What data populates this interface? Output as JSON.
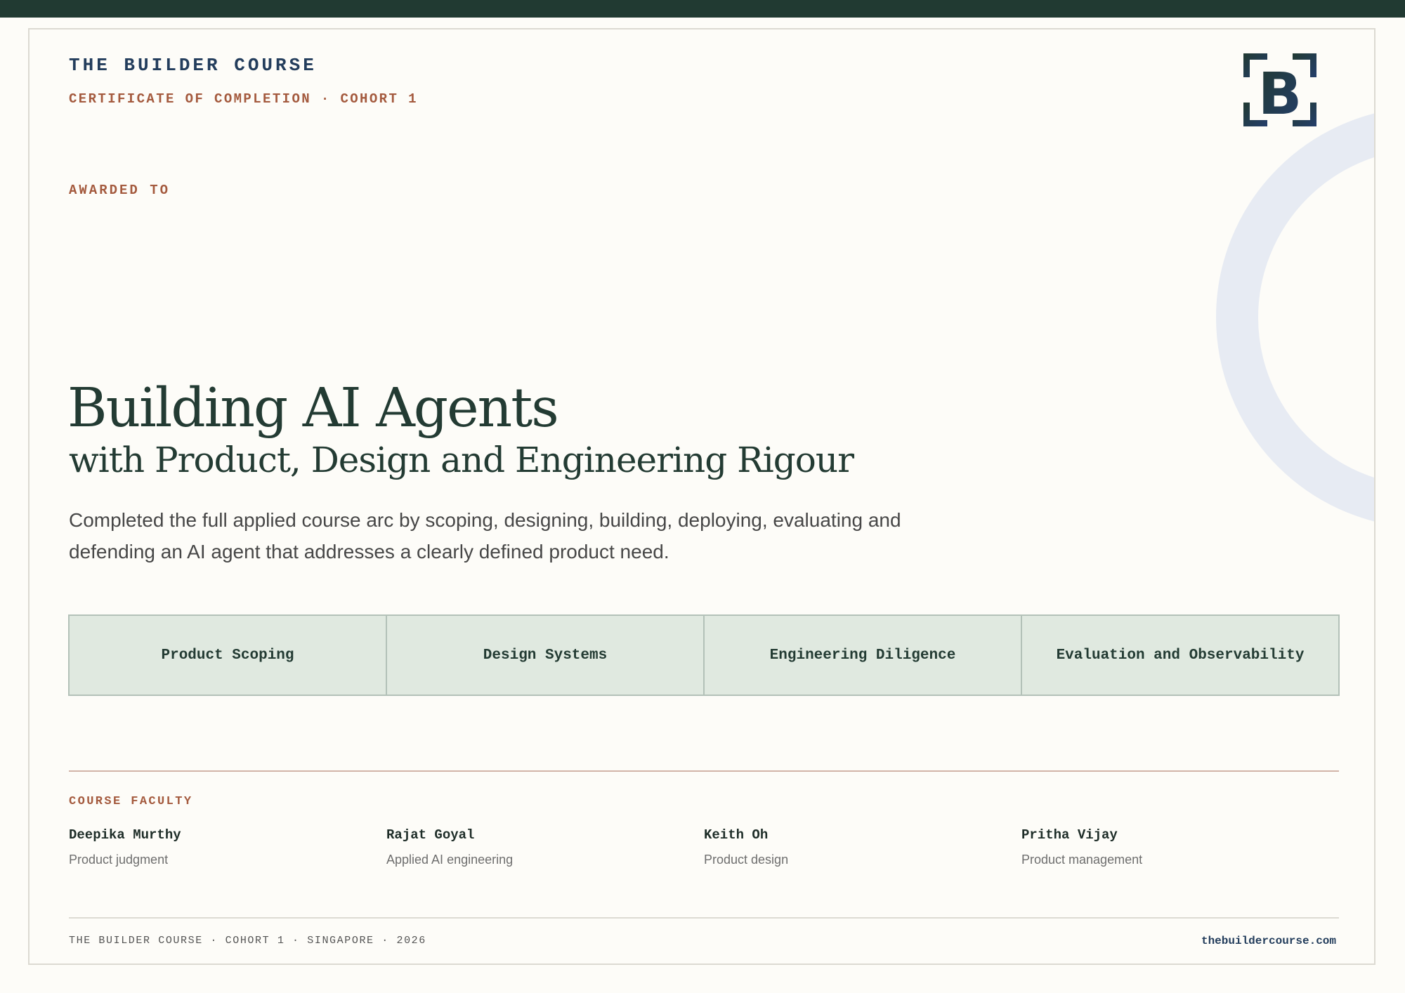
{
  "header": {
    "brand": "THE BUILDER COURSE",
    "subheading": "CERTIFICATE OF COMPLETION · COHORT 1"
  },
  "logo": {
    "icon": "bracket-b-logo-icon",
    "letter": "B"
  },
  "award": {
    "label": "AWARDED TO",
    "recipient": ""
  },
  "course": {
    "title": "Building AI Agents",
    "subtitle": "with Product, Design and Engineering Rigour",
    "description": "Completed the full applied course arc by scoping, designing, building, deploying, evaluating and defending an AI agent that addresses a clearly defined product need."
  },
  "skills": [
    "Product Scoping",
    "Design Systems",
    "Engineering Diligence",
    "Evaluation and Observability"
  ],
  "faculty": {
    "label": "COURSE FACULTY",
    "members": [
      {
        "name": "Deepika Murthy",
        "role": "Product judgment"
      },
      {
        "name": "Rajat Goyal",
        "role": "Applied AI engineering"
      },
      {
        "name": "Keith Oh",
        "role": "Product design"
      },
      {
        "name": "Pritha Vijay",
        "role": "Product management"
      }
    ]
  },
  "footer": {
    "left": "THE BUILDER COURSE · COHORT 1 · SINGAPORE · 2026",
    "right": "thebuildercourse.com"
  },
  "colors": {
    "top_bar": "#213a32",
    "navy": "#233d5c",
    "accent_rust": "#a45a3e",
    "heading_green": "#233b33",
    "skill_fill": "#e0e9e0",
    "ring": "#e7ebf3",
    "background": "#fdfcf8"
  }
}
